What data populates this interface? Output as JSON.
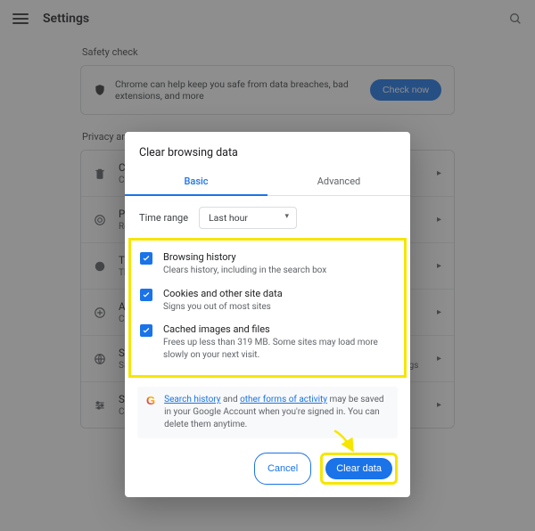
{
  "header": {
    "title": "Settings"
  },
  "safety": {
    "section_label": "Safety check",
    "text": "Chrome can help keep you safe from data breaches, bad extensions, and more",
    "button": "Check now"
  },
  "privacy": {
    "section_label": "Privacy and security",
    "rows": [
      {
        "title": "Clear browsing data",
        "sub": "Clear history, cookies, cache, and more"
      },
      {
        "title": "Privacy Guide",
        "sub": "Review key privacy and security controls"
      },
      {
        "title": "Third-party cookies",
        "sub": "Third-party cookies are blocked in Incognito mode"
      },
      {
        "title": "Ad privacy",
        "sub": "Customize the info used by sites to show you ads"
      },
      {
        "title": "Security",
        "sub": "Safe Browsing (protection from dangerous sites) and other security settings"
      },
      {
        "title": "Site settings",
        "sub": "Controls what information sites can use and show"
      }
    ]
  },
  "dialog": {
    "title": "Clear browsing data",
    "tabs": {
      "basic": "Basic",
      "advanced": "Advanced"
    },
    "time_range_label": "Time range",
    "time_range_value": "Last hour",
    "items": [
      {
        "title": "Browsing history",
        "sub": "Clears history, including in the search box"
      },
      {
        "title": "Cookies and other site data",
        "sub": "Signs you out of most sites"
      },
      {
        "title": "Cached images and files",
        "sub": "Frees up less than 319 MB. Some sites may load more slowly on your next visit."
      }
    ],
    "note": {
      "link1": "Search history",
      "mid": " and ",
      "link2": "other forms of activity",
      "tail": " may be saved in your Google Account when you're signed in. You can delete them anytime."
    },
    "buttons": {
      "cancel": "Cancel",
      "clear": "Clear data"
    }
  }
}
